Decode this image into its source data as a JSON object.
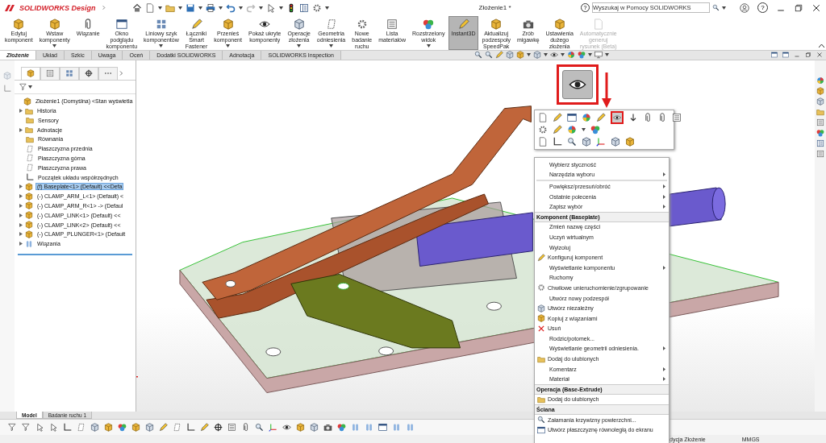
{
  "app": {
    "logo": "SOLIDWORKS Design",
    "title": "Złożenie1 *"
  },
  "search": {
    "help_mark": "?",
    "placeholder": "Wyszukaj w Pomocy SOLIDWORKS"
  },
  "window_help": "?",
  "ribbon": [
    {
      "label": "Edytuj\nkomponent",
      "dropdown": false,
      "selected": false,
      "disabled": false
    },
    {
      "label": "Wstaw\nkomponenty",
      "dropdown": true,
      "selected": false,
      "disabled": false
    },
    {
      "label": "Wiązanie",
      "dropdown": false,
      "selected": false,
      "disabled": false
    },
    {
      "label": "Okno\npodglądu\nkomponentu",
      "dropdown": false,
      "selected": false,
      "disabled": false
    },
    {
      "label": "Liniowy szyk\nkomponentów",
      "dropdown": true,
      "selected": false,
      "disabled": false
    },
    {
      "label": "Łączniki\nSmart\nFastener",
      "dropdown": false,
      "selected": false,
      "disabled": false
    },
    {
      "label": "Przenieś\nkomponent",
      "dropdown": true,
      "selected": false,
      "disabled": false
    },
    {
      "label": "Pokaż ukryte\nkomponenty",
      "dropdown": false,
      "selected": false,
      "disabled": false
    },
    {
      "label": "Operacje\nzłożenia",
      "dropdown": true,
      "selected": false,
      "disabled": false
    },
    {
      "label": "Geometria\nodniesienia",
      "dropdown": true,
      "selected": false,
      "disabled": false
    },
    {
      "label": "Nowe\nbadanie\nruchu",
      "dropdown": false,
      "selected": false,
      "disabled": false
    },
    {
      "label": "Lista\nmateriałów",
      "dropdown": false,
      "selected": false,
      "disabled": false
    },
    {
      "label": "Rozstrzelony\nwidok",
      "dropdown": true,
      "selected": false,
      "disabled": false
    },
    {
      "label": "Instant3D",
      "dropdown": false,
      "selected": true,
      "disabled": false
    },
    {
      "label": "Aktualizuj\npodzespoły\nSpeedPak",
      "dropdown": false,
      "selected": false,
      "disabled": false
    },
    {
      "label": "Zrób\nmigawkę",
      "dropdown": false,
      "selected": false,
      "disabled": false
    },
    {
      "label": "Ustawienia\ndużego\nzłożenia",
      "dropdown": false,
      "selected": false,
      "disabled": false
    },
    {
      "label": "Automatycznie\ngeneruj\nrysunek (Beta)",
      "dropdown": false,
      "selected": false,
      "disabled": true
    }
  ],
  "tabs": [
    {
      "label": "Złożenie",
      "selected": true
    },
    {
      "label": "Układ",
      "selected": false
    },
    {
      "label": "Szkic",
      "selected": false
    },
    {
      "label": "Uwaga",
      "selected": false
    },
    {
      "label": "Oceń",
      "selected": false
    },
    {
      "label": "Dodatki SOLIDWORKS",
      "selected": false
    },
    {
      "label": "Adnotacja",
      "selected": false
    },
    {
      "label": "SOLIDWORKS Inspection",
      "selected": false
    }
  ],
  "tree": {
    "label": "Złożenie1 (Domyślna) <Stan wyświetla",
    "selected": false,
    "children": [
      {
        "label": "Historia",
        "kind": "folder",
        "collapsed": true,
        "selected": false
      },
      {
        "label": "Sensory",
        "kind": "folder",
        "collapsed": false,
        "selected": false
      },
      {
        "label": "Adnotacje",
        "kind": "folder",
        "collapsed": true,
        "selected": false
      },
      {
        "label": "Równania",
        "kind": "folder",
        "collapsed": false,
        "selected": false
      },
      {
        "label": "Płaszczyzna przednia",
        "kind": "plane",
        "collapsed": false,
        "selected": false
      },
      {
        "label": "Płaszczyzna górna",
        "kind": "plane",
        "collapsed": false,
        "selected": false
      },
      {
        "label": "Płaszczyzna prawa",
        "kind": "plane",
        "collapsed": false,
        "selected": false
      },
      {
        "label": "Początek układu współrzędnych",
        "kind": "origin",
        "collapsed": false,
        "selected": false
      },
      {
        "label": "(f) Baseplate<1> (Default) <<Defa",
        "kind": "component",
        "collapsed": true,
        "selected": true
      },
      {
        "label": "(-) CLAMP_ARM_L<1> (Default) <",
        "kind": "component",
        "collapsed": true,
        "selected": false
      },
      {
        "label": "(-) CLAMP_ARM_R<1> -> (Defaul",
        "kind": "component",
        "collapsed": true,
        "selected": false
      },
      {
        "label": "(-) CLAMP_LINK<1> (Default) <<",
        "kind": "component",
        "collapsed": true,
        "selected": false
      },
      {
        "label": "(-) CLAMP_LINK<2> (Default) <<",
        "kind": "component",
        "collapsed": true,
        "selected": false
      },
      {
        "label": "(-) CLAMP_PLUNGER<1> (Default",
        "kind": "component",
        "collapsed": true,
        "selected": false
      },
      {
        "label": "Wiązania",
        "kind": "mates",
        "collapsed": true,
        "selected": false
      }
    ]
  },
  "context_menu": [
    {
      "kind": "item",
      "label": "Wybierz styczność",
      "submenu": false
    },
    {
      "kind": "item",
      "label": "Narzędzia wyboru",
      "submenu": true
    },
    {
      "kind": "separator"
    },
    {
      "kind": "item",
      "label": "Powiększ/przesuń/obróć",
      "submenu": true
    },
    {
      "kind": "item",
      "label": "Ostatnie polecenia",
      "submenu": true
    },
    {
      "kind": "item",
      "label": "Zapisz wybór",
      "submenu": true
    },
    {
      "kind": "header",
      "label": "Komponent (Baseplate)"
    },
    {
      "kind": "item",
      "label": "Zmień nazwę części",
      "submenu": false
    },
    {
      "kind": "item",
      "label": "Uczyń wirtualnym",
      "submenu": false
    },
    {
      "kind": "item",
      "label": "Wyizoluj",
      "submenu": false
    },
    {
      "kind": "item",
      "label": "Konfiguruj komponent",
      "submenu": false
    },
    {
      "kind": "item",
      "label": "Wyświetlanie komponentu",
      "submenu": true
    },
    {
      "kind": "item",
      "label": "Ruchomy",
      "submenu": false
    },
    {
      "kind": "item",
      "label": "Chwilowe unieruchomienie/zgrupowanie",
      "submenu": false
    },
    {
      "kind": "item",
      "label": "Utwórz nowy podzespół",
      "submenu": false
    },
    {
      "kind": "item",
      "label": "Utwórz niezależny",
      "submenu": false
    },
    {
      "kind": "item",
      "label": "Kopiuj z wiązaniami",
      "submenu": false
    },
    {
      "kind": "item",
      "label": "Usuń",
      "submenu": false
    },
    {
      "kind": "item",
      "label": "Rodzic/potomek...",
      "submenu": false
    },
    {
      "kind": "item",
      "label": "Wyświetlanie geometrii odniesienia.",
      "submenu": true
    },
    {
      "kind": "item",
      "label": "Dodaj do ulubionych",
      "submenu": false
    },
    {
      "kind": "item",
      "label": "Komentarz",
      "submenu": true
    },
    {
      "kind": "item",
      "label": "Materiał",
      "submenu": true
    },
    {
      "kind": "header",
      "label": "Operacja (Base-Extrude)"
    },
    {
      "kind": "item",
      "label": "Dodaj do ulubionych",
      "submenu": false
    },
    {
      "kind": "header",
      "label": "Ściana"
    },
    {
      "kind": "item",
      "label": "Załamania krzywizny powierzchni...",
      "submenu": false
    },
    {
      "kind": "item",
      "label": "Utwórz płaszczyznę równoległą do ekranu",
      "submenu": false
    }
  ],
  "bottom_tabs": [
    {
      "label": "Model",
      "selected": true
    },
    {
      "label": "Badanie ruchu 1",
      "selected": false
    }
  ],
  "status_bar": {
    "mode": "dycja Złożenie",
    "units": "MMGS"
  }
}
